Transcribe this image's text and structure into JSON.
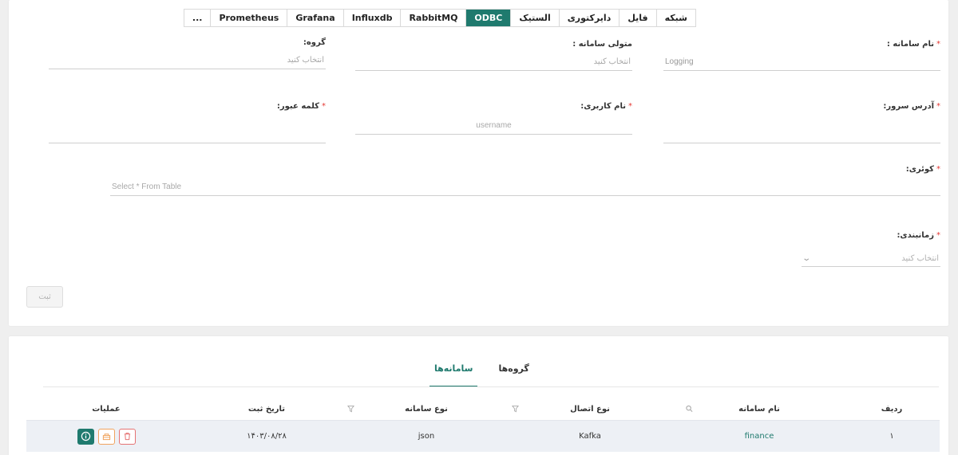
{
  "tabs": [
    {
      "label": "شبکه",
      "active": false
    },
    {
      "label": "فایل",
      "active": false
    },
    {
      "label": "دایرکتوری",
      "active": false
    },
    {
      "label": "الستیک",
      "active": false
    },
    {
      "label": "ODBC",
      "active": true
    },
    {
      "label": "RabbitMQ",
      "active": false
    },
    {
      "label": "Influxdb",
      "active": false
    },
    {
      "label": "Grafana",
      "active": false
    },
    {
      "label": "Prometheus",
      "active": false
    },
    {
      "label": "...",
      "active": false
    }
  ],
  "form": {
    "system_name": {
      "label": "نام سامانه :",
      "value": "Logging"
    },
    "system_owner": {
      "label": "متولی سامانه :",
      "placeholder": "انتخاب کنید"
    },
    "group": {
      "label": "گروه:",
      "placeholder": "انتخاب کنید"
    },
    "server_address": {
      "label": "آدرس سرور:",
      "value": ""
    },
    "username": {
      "label": "نام کاربری:",
      "placeholder": "username"
    },
    "password": {
      "label": "کلمه عبور:",
      "value": ""
    },
    "query": {
      "label": "کوئری:",
      "placeholder": "Select * From Table"
    },
    "schedule": {
      "label": "زمانبندی:",
      "placeholder": "انتخاب کنید"
    },
    "submit_label": "ثبت"
  },
  "list": {
    "tabs": [
      {
        "label": "سامانه‌ها",
        "active": true
      },
      {
        "label": "گروه‌ها",
        "active": false
      }
    ],
    "columns": [
      "ردیف",
      "نام سامانه",
      "نوع اتصال",
      "نوع سامانه",
      "تاریخ ثبت",
      "عملیات"
    ],
    "rows": [
      {
        "index": "۱",
        "name": "finance",
        "connection": "Kafka",
        "type": "json",
        "date": "۱۴۰۳/۰۸/۲۸"
      }
    ]
  },
  "colors": {
    "primary": "#1f7a6e",
    "required": "#e53935",
    "edit": "#f0a35e",
    "delete": "#e57373"
  },
  "icons": {
    "search": "search-icon",
    "filter": "filter-icon",
    "info": "info-icon",
    "edit": "edit-icon",
    "delete": "trash-icon",
    "select": "chevron-down-icon"
  }
}
